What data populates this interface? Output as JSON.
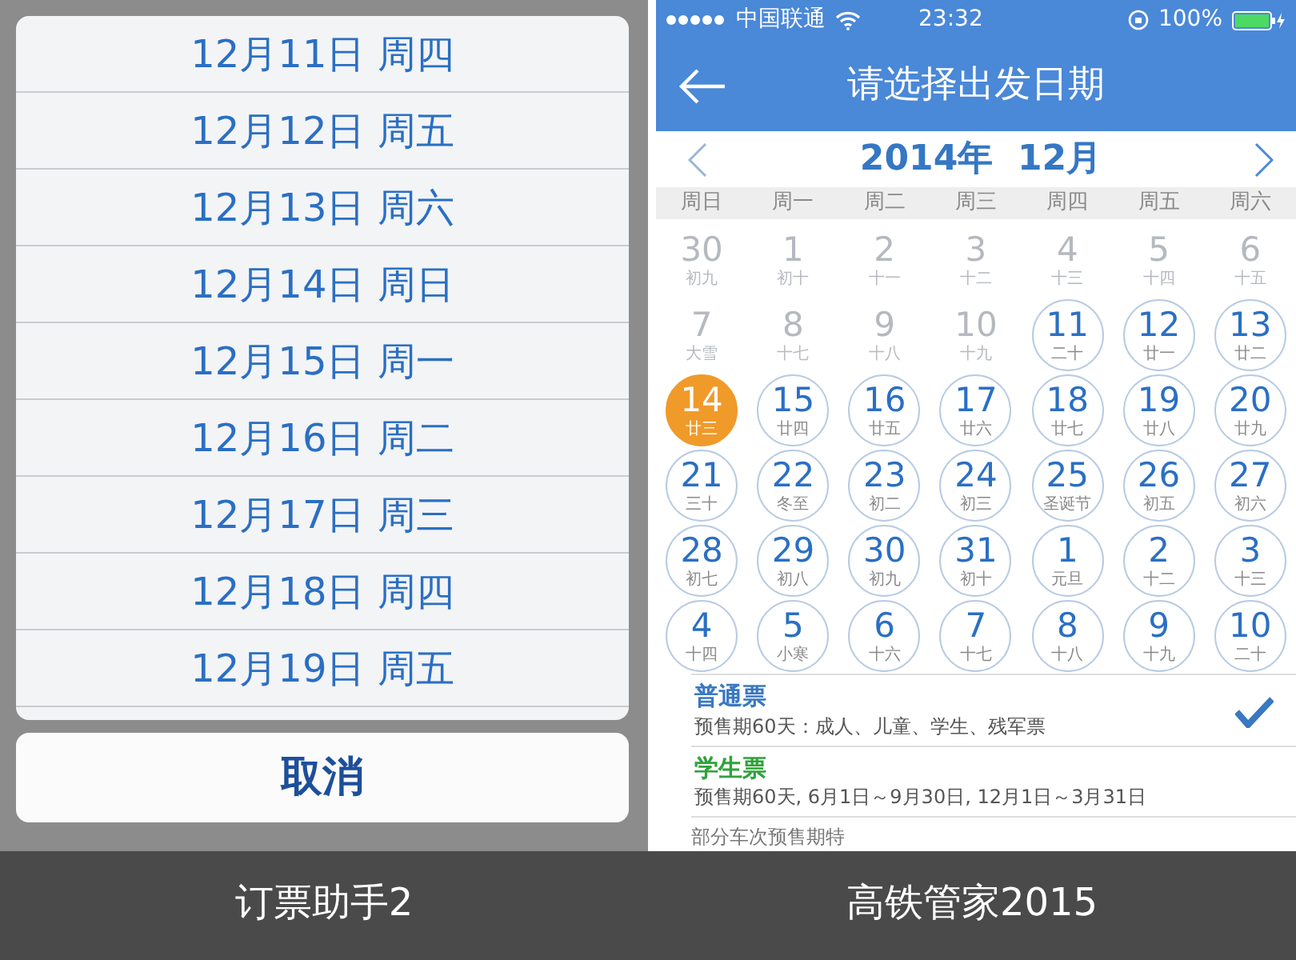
{
  "left_panel": {
    "date_options": [
      "12月11日 周四",
      "12月12日 周五",
      "12月13日 周六",
      "12月14日 周日",
      "12月15日 周一",
      "12月16日 周二",
      "12月17日 周三",
      "12月18日 周四",
      "12月19日 周五"
    ],
    "cancel_button": "取消",
    "caption": "订票助手2"
  },
  "right_panel": {
    "status_bar": {
      "carrier": "中国联通",
      "time": "23:32",
      "battery": "100%"
    },
    "title": "请选择出发日期",
    "month": "2014年  12月",
    "weekdays": [
      "周日",
      "周一",
      "周二",
      "周三",
      "周四",
      "周五",
      "周六"
    ],
    "days": [
      {
        "day": "30",
        "lunar": "初九",
        "disabled": true,
        "selected": false
      },
      {
        "day": "1",
        "lunar": "初十",
        "disabled": true,
        "selected": false
      },
      {
        "day": "2",
        "lunar": "十一",
        "disabled": true,
        "selected": false
      },
      {
        "day": "3",
        "lunar": "十二",
        "disabled": true,
        "selected": false
      },
      {
        "day": "4",
        "lunar": "十三",
        "disabled": true,
        "selected": false
      },
      {
        "day": "5",
        "lunar": "十四",
        "disabled": true,
        "selected": false
      },
      {
        "day": "6",
        "lunar": "十五",
        "disabled": true,
        "selected": false
      },
      {
        "day": "7",
        "lunar": "大雪",
        "disabled": true,
        "selected": false
      },
      {
        "day": "8",
        "lunar": "十七",
        "disabled": true,
        "selected": false
      },
      {
        "day": "9",
        "lunar": "十八",
        "disabled": true,
        "selected": false
      },
      {
        "day": "10",
        "lunar": "十九",
        "disabled": true,
        "selected": false
      },
      {
        "day": "11",
        "lunar": "二十",
        "disabled": false,
        "selected": false
      },
      {
        "day": "12",
        "lunar": "廿一",
        "disabled": false,
        "selected": false
      },
      {
        "day": "13",
        "lunar": "廿二",
        "disabled": false,
        "selected": false
      },
      {
        "day": "14",
        "lunar": "廿三",
        "disabled": false,
        "selected": true
      },
      {
        "day": "15",
        "lunar": "廿四",
        "disabled": false,
        "selected": false
      },
      {
        "day": "16",
        "lunar": "廿五",
        "disabled": false,
        "selected": false
      },
      {
        "day": "17",
        "lunar": "廿六",
        "disabled": false,
        "selected": false
      },
      {
        "day": "18",
        "lunar": "廿七",
        "disabled": false,
        "selected": false
      },
      {
        "day": "19",
        "lunar": "廿八",
        "disabled": false,
        "selected": false
      },
      {
        "day": "20",
        "lunar": "廿九",
        "disabled": false,
        "selected": false
      },
      {
        "day": "21",
        "lunar": "三十",
        "disabled": false,
        "selected": false
      },
      {
        "day": "22",
        "lunar": "冬至",
        "disabled": false,
        "selected": false
      },
      {
        "day": "23",
        "lunar": "初二",
        "disabled": false,
        "selected": false
      },
      {
        "day": "24",
        "lunar": "初三",
        "disabled": false,
        "selected": false
      },
      {
        "day": "25",
        "lunar": "圣诞节",
        "disabled": false,
        "selected": false
      },
      {
        "day": "26",
        "lunar": "初五",
        "disabled": false,
        "selected": false
      },
      {
        "day": "27",
        "lunar": "初六",
        "disabled": false,
        "selected": false
      },
      {
        "day": "28",
        "lunar": "初七",
        "disabled": false,
        "selected": false
      },
      {
        "day": "29",
        "lunar": "初八",
        "disabled": false,
        "selected": false
      },
      {
        "day": "30",
        "lunar": "初九",
        "disabled": false,
        "selected": false
      },
      {
        "day": "31",
        "lunar": "初十",
        "disabled": false,
        "selected": false
      },
      {
        "day": "1",
        "lunar": "元旦",
        "disabled": false,
        "selected": false
      },
      {
        "day": "2",
        "lunar": "十二",
        "disabled": false,
        "selected": false
      },
      {
        "day": "3",
        "lunar": "十三",
        "disabled": false,
        "selected": false
      },
      {
        "day": "4",
        "lunar": "十四",
        "disabled": false,
        "selected": false
      },
      {
        "day": "5",
        "lunar": "小寒",
        "disabled": false,
        "selected": false
      },
      {
        "day": "6",
        "lunar": "十六",
        "disabled": false,
        "selected": false
      },
      {
        "day": "7",
        "lunar": "十七",
        "disabled": false,
        "selected": false
      },
      {
        "day": "8",
        "lunar": "十八",
        "disabled": false,
        "selected": false
      },
      {
        "day": "9",
        "lunar": "十九",
        "disabled": false,
        "selected": false
      },
      {
        "day": "10",
        "lunar": "二十",
        "disabled": false,
        "selected": false
      }
    ],
    "ticket_types": [
      {
        "name": "普通票",
        "description": "预售期60天：成人、儿童、学生、残军票",
        "color": "#3a78c2",
        "checked": true
      },
      {
        "name": "学生票",
        "description": "预售期60天, 6月1日～9月30日, 12月1日～3月31日",
        "color": "#2fa33a",
        "checked": false
      }
    ],
    "note": "部分车次预售期特",
    "caption": "高铁管家2015"
  }
}
